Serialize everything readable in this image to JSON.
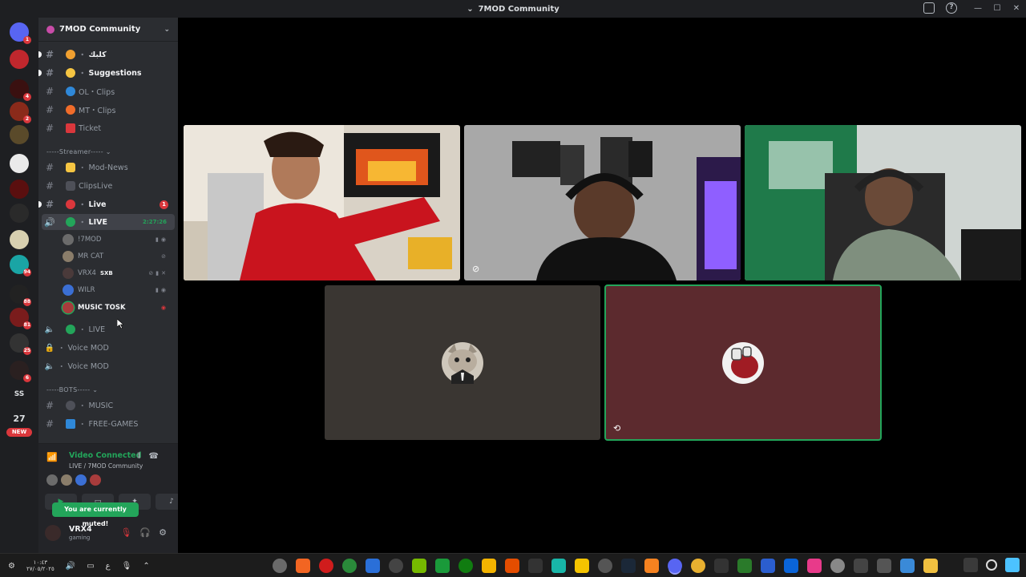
{
  "window": {
    "title": "7MOD Community",
    "controls": [
      "—",
      "☐",
      "✕"
    ]
  },
  "servers": {
    "badges": [
      "1",
      "4",
      "2",
      "94",
      "88",
      "81",
      "25",
      "6"
    ],
    "text_items": [
      "SS",
      "27",
      "NEW"
    ]
  },
  "guild": {
    "name": "7MOD Community"
  },
  "channels": [
    {
      "name": "كلبك",
      "emoji_color": "#f0a030",
      "bold": true,
      "unread": true
    },
    {
      "name": "Suggestions",
      "emoji_color": "#f5c542",
      "bold": true,
      "unread": true
    },
    {
      "name": "OL・Clips",
      "emoji_color": "#2f88d8",
      "bold": false,
      "unread": false
    },
    {
      "name": "MT・Clips",
      "emoji_color": "#f06c2a",
      "bold": false,
      "unread": false
    },
    {
      "name": "Ticket",
      "emoji_color": "#da373c",
      "bold": false,
      "unread": false
    }
  ],
  "category_streamer": "-----Streamer----- ⌄",
  "streamer_channels": [
    {
      "name": "Mod-News",
      "emoji_color": "#f5c542"
    },
    {
      "name": "ClipsLive",
      "emoji_color": "#b5bac1"
    }
  ],
  "live_text_channel": {
    "name": "Live",
    "badge": "1"
  },
  "live_voice_channel": {
    "name": "LIVE",
    "timer": "2:27:26"
  },
  "voice_users": [
    {
      "name": "!7MOD",
      "avatar_color": "#6b6b6b",
      "speaking": false
    },
    {
      "name": "MR CAT",
      "avatar_color": "#8a7d6a",
      "speaking": false
    },
    {
      "name": "VRX4",
      "tag": "SXB",
      "avatar_color": "#4a3a3a",
      "speaking": false
    },
    {
      "name": "WILR",
      "avatar_color": "#3b6fd4",
      "speaking": false
    },
    {
      "name": "MUSIC TOSK",
      "avatar_color": "#a83c3c",
      "speaking": true
    }
  ],
  "other_voice": [
    {
      "name": "LIVE",
      "locked": false
    },
    {
      "name": "Voice MOD",
      "locked": true
    },
    {
      "name": "Voice MOD",
      "locked": false
    }
  ],
  "category_bots": "-----BOTS----- ⌄",
  "bot_channels": [
    {
      "name": "MUSIC",
      "emoji_color": "#80848e"
    },
    {
      "name": "FREE-GAMES",
      "emoji_color": "#2f88d8"
    }
  ],
  "voice_panel": {
    "status": "Video Connected",
    "location": "LIVE / 7MOD Community",
    "tooltip": "You are currently muted!"
  },
  "user": {
    "name": "VRX4",
    "status": "gaming"
  },
  "stage_tiles": {
    "colors": {
      "cam_idle_bg": "#3a3632",
      "speaking_bg": "#5c2a2e",
      "speaking_border": "#23a55a"
    }
  },
  "taskbar": {
    "clock_time": "١٠:٤٣",
    "clock_date": "٢٧/٠٥/٢٠٢٥",
    "lang": "ع"
  }
}
